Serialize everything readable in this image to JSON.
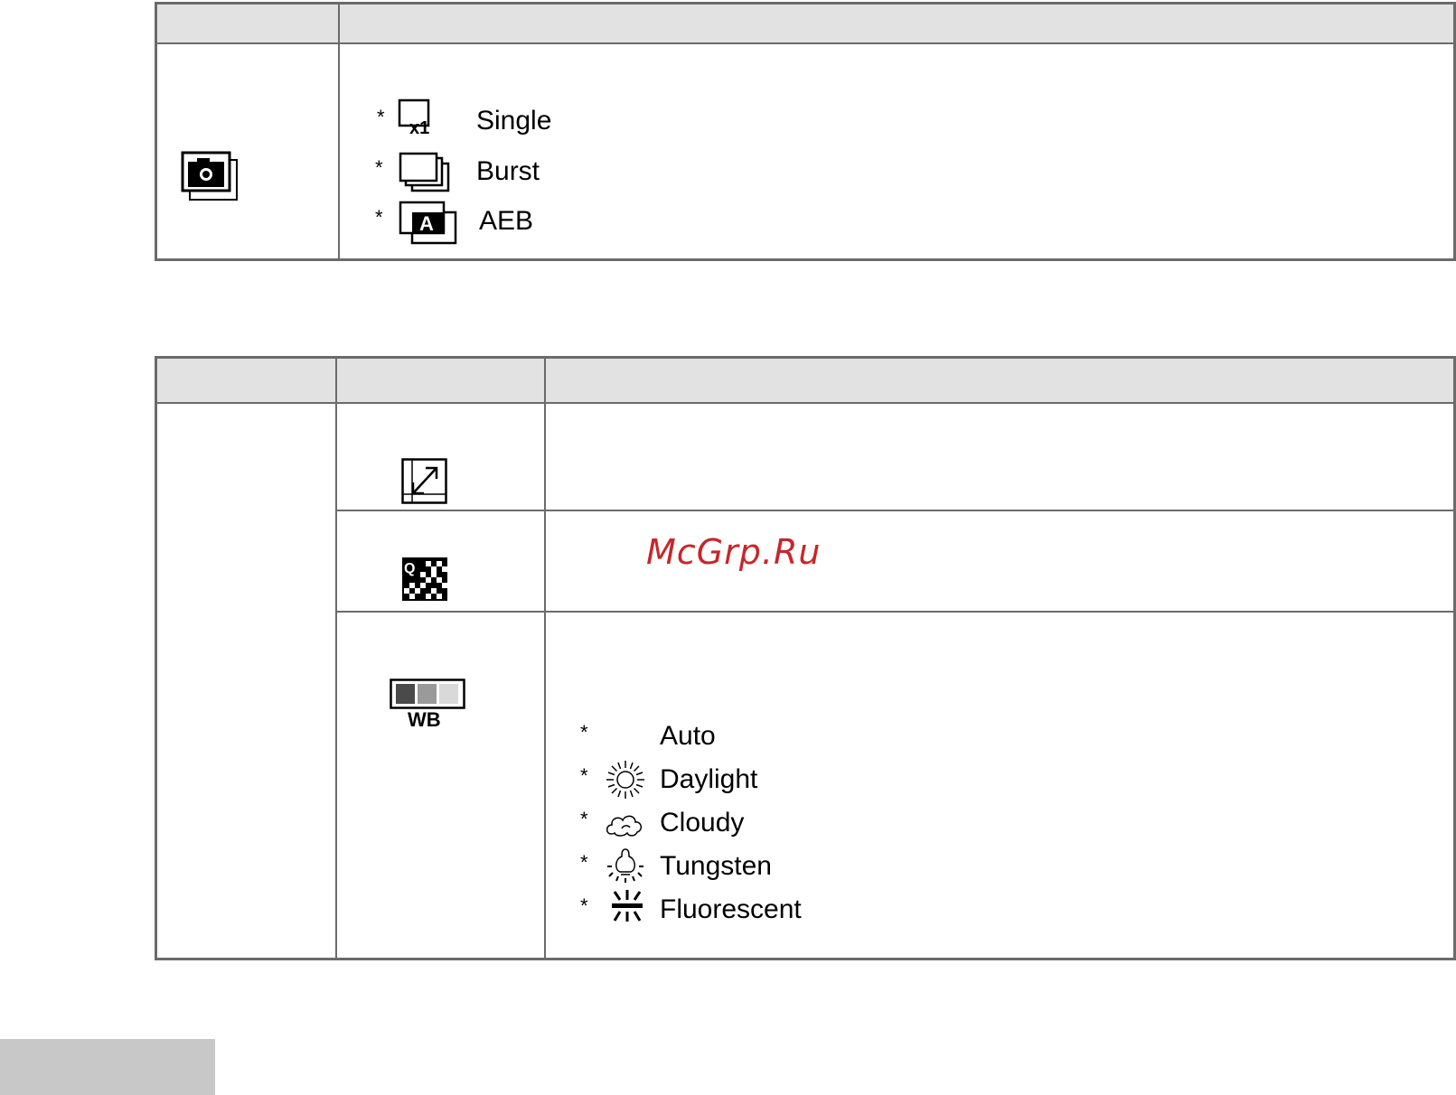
{
  "drive_mode_table": {
    "row_icon": "drive-mode-icon",
    "options": [
      {
        "marker": "*",
        "icon": "single-shot-icon",
        "label": "Single"
      },
      {
        "marker": "*",
        "icon": "burst-icon",
        "label": "Burst"
      },
      {
        "marker": "*",
        "icon": "aeb-icon",
        "label": "AEB"
      }
    ]
  },
  "settings_table": {
    "rows": [
      {
        "icon": "size-icon"
      },
      {
        "icon": "quality-icon",
        "watermark": "McGrp.Ru"
      },
      {
        "icon": "white-balance-icon",
        "icon_label": "WB",
        "options": [
          {
            "marker": "*",
            "icon": "",
            "label": "Auto"
          },
          {
            "marker": "*",
            "icon": "daylight-icon",
            "label": "Daylight"
          },
          {
            "marker": "*",
            "icon": "cloudy-icon",
            "label": "Cloudy"
          },
          {
            "marker": "*",
            "icon": "tungsten-icon",
            "label": "Tungsten"
          },
          {
            "marker": "*",
            "icon": "fluorescent-icon",
            "label": "Fluorescent"
          }
        ]
      }
    ]
  },
  "colors": {
    "border": "#6b6b6b",
    "header_fill": "#e2e2e2",
    "watermark": "#c8262a",
    "footer_block": "#c8c8c8"
  }
}
